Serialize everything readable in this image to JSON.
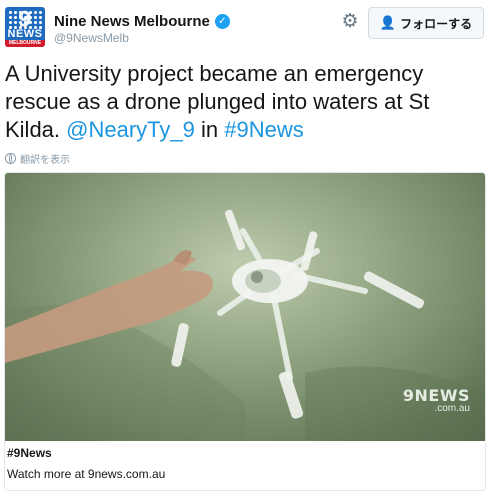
{
  "account": {
    "display_name": "Nine News Melbourne",
    "handle": "@9NewsMelb",
    "avatar": {
      "top_text": "9",
      "news_text": "NEWS",
      "sub_text": "MELBOURNE"
    }
  },
  "actions": {
    "settings_icon": "gear-icon",
    "follow_label": "フォローする",
    "follow_icon": "add-user-icon"
  },
  "tweet": {
    "text_part1": "A University project became an emergency rescue as a drone plunged into waters at St Kilda. ",
    "mention": "@NearyTy_9",
    "text_part2": " in ",
    "hashtag": "#9News",
    "translate_label": "翻訳を表示"
  },
  "media": {
    "watermark_main": "9NEWS",
    "watermark_sub": ".com.au"
  },
  "card": {
    "title": "#9News",
    "description": "Watch more at 9news.com.au"
  },
  "colors": {
    "link": "#1b95e0",
    "verified": "#1da1f2",
    "muted": "#8899a6",
    "water": "#9fb28c"
  }
}
